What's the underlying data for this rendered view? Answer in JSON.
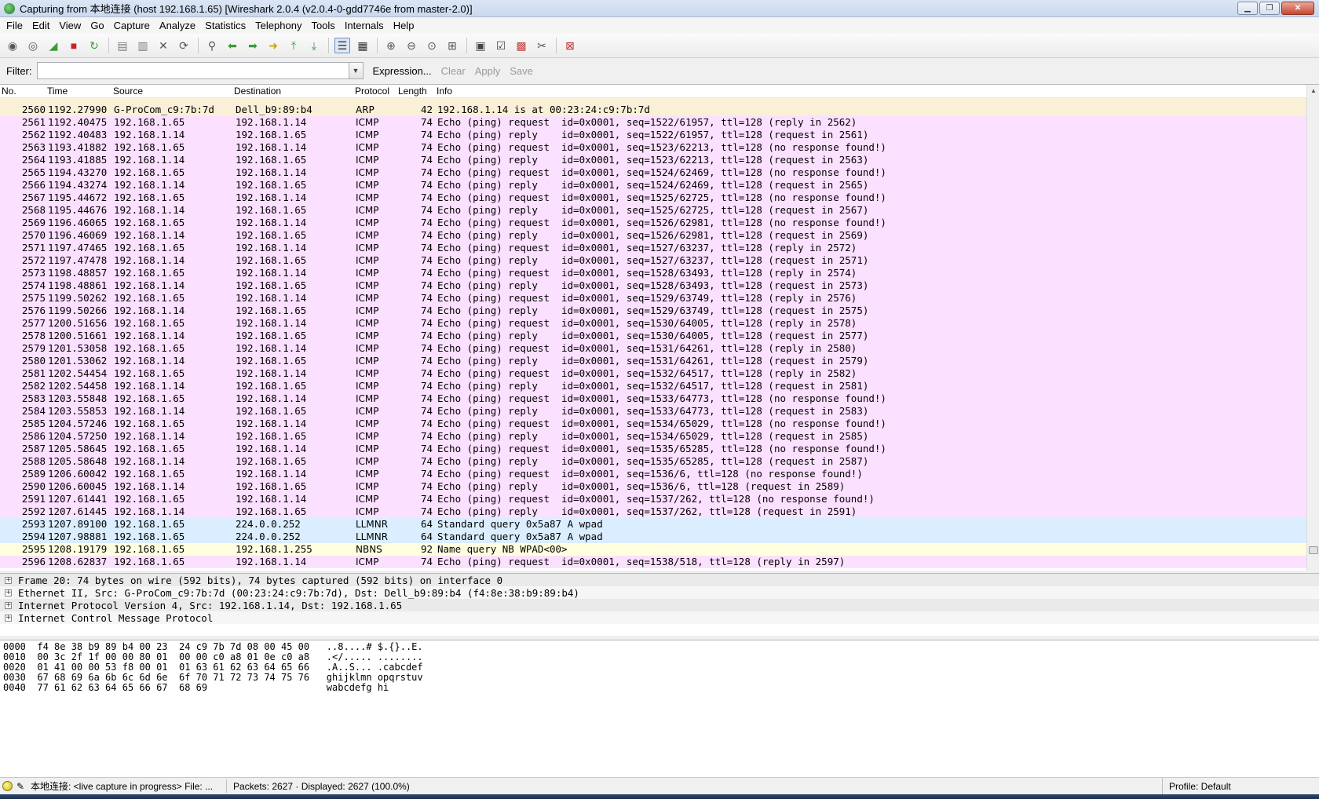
{
  "window": {
    "title": "Capturing from 本地连接 (host 192.168.1.65) [Wireshark 2.0.4 (v2.0.4-0-gdd7746e from master-2.0)]",
    "buttons": [
      "minimize",
      "maximize",
      "close"
    ]
  },
  "menu": [
    "File",
    "Edit",
    "View",
    "Go",
    "Capture",
    "Analyze",
    "Statistics",
    "Telephony",
    "Tools",
    "Internals",
    "Help"
  ],
  "toolbar": {
    "icons": [
      {
        "name": "interfaces-icon",
        "glyph": "◉",
        "color": "#555555"
      },
      {
        "name": "options-icon",
        "glyph": "◎",
        "color": "#555555"
      },
      {
        "name": "start-capture-icon",
        "glyph": "◢",
        "color": "#3c9a3c"
      },
      {
        "name": "stop-capture-icon",
        "glyph": "■",
        "color": "#d02020"
      },
      {
        "name": "restart-capture-icon",
        "glyph": "↻",
        "color": "#3c9a3c"
      },
      {
        "name": "sep",
        "glyph": "",
        "color": ""
      },
      {
        "name": "open-file-icon",
        "glyph": "▤",
        "color": "#7a7a7a"
      },
      {
        "name": "save-file-icon",
        "glyph": "▥",
        "color": "#7a7a7a"
      },
      {
        "name": "close-file-icon",
        "glyph": "✕",
        "color": "#555555"
      },
      {
        "name": "reload-icon",
        "glyph": "⟳",
        "color": "#555555"
      },
      {
        "name": "sep",
        "glyph": "",
        "color": ""
      },
      {
        "name": "find-packet-icon",
        "glyph": "⚲",
        "color": "#555555"
      },
      {
        "name": "go-back-icon",
        "glyph": "⬅",
        "color": "#3c9a3c"
      },
      {
        "name": "go-forward-icon",
        "glyph": "➡",
        "color": "#3c9a3c"
      },
      {
        "name": "go-to-packet-icon",
        "glyph": "➜",
        "color": "#c9a400"
      },
      {
        "name": "first-packet-icon",
        "glyph": "⤒",
        "color": "#3c9a3c"
      },
      {
        "name": "last-packet-icon",
        "glyph": "⤓",
        "color": "#3c9a3c"
      },
      {
        "name": "sep",
        "glyph": "",
        "color": ""
      },
      {
        "name": "colorize-icon",
        "glyph": "☰",
        "color": "#333333"
      },
      {
        "name": "auto-scroll-icon",
        "glyph": "▦",
        "color": "#333333"
      },
      {
        "name": "sep",
        "glyph": "",
        "color": ""
      },
      {
        "name": "zoom-in-icon",
        "glyph": "⊕",
        "color": "#555555"
      },
      {
        "name": "zoom-out-icon",
        "glyph": "⊖",
        "color": "#555555"
      },
      {
        "name": "normal-size-icon",
        "glyph": "⊙",
        "color": "#555555"
      },
      {
        "name": "resize-columns-icon",
        "glyph": "⊞",
        "color": "#555555"
      },
      {
        "name": "sep",
        "glyph": "",
        "color": ""
      },
      {
        "name": "capture-filters-icon",
        "glyph": "▣",
        "color": "#444444"
      },
      {
        "name": "display-filters-icon",
        "glyph": "☑",
        "color": "#444444"
      },
      {
        "name": "coloring-rules-icon",
        "glyph": "▩",
        "color": "#c04040"
      },
      {
        "name": "preferences-icon",
        "glyph": "✂",
        "color": "#555555"
      },
      {
        "name": "sep",
        "glyph": "",
        "color": ""
      },
      {
        "name": "help-icon",
        "glyph": "⊠",
        "color": "#c03030"
      }
    ]
  },
  "filter": {
    "label": "Filter:",
    "value": "",
    "buttons": {
      "expression": "Expression...",
      "clear": "Clear",
      "apply": "Apply",
      "save": "Save"
    }
  },
  "packet_list": {
    "columns": [
      "No.",
      "Time",
      "Source",
      "Destination",
      "Protocol",
      "Length",
      "Info"
    ],
    "colors": {
      "arp": "#faf0d7",
      "icmp": "#fce0ff",
      "llmnr": "#daeeff",
      "nbns": "#ffffe0"
    },
    "rows": [
      {
        "kind": "arp",
        "no": "2560",
        "time": "1192.27990",
        "src": "G-ProCom_c9:7b:7d",
        "dst": "Dell_b9:89:b4",
        "proto": "ARP",
        "len": "42",
        "info": "192.168.1.14 is at 00:23:24:c9:7b:7d"
      },
      {
        "kind": "icmp",
        "no": "2561",
        "time": "1192.40475",
        "src": "192.168.1.65",
        "dst": "192.168.1.14",
        "proto": "ICMP",
        "len": "74",
        "info": "Echo (ping) request  id=0x0001, seq=1522/61957, ttl=128 (reply in 2562)"
      },
      {
        "kind": "icmp",
        "no": "2562",
        "time": "1192.40483",
        "src": "192.168.1.14",
        "dst": "192.168.1.65",
        "proto": "ICMP",
        "len": "74",
        "info": "Echo (ping) reply    id=0x0001, seq=1522/61957, ttl=128 (request in 2561)"
      },
      {
        "kind": "icmp",
        "no": "2563",
        "time": "1193.41882",
        "src": "192.168.1.65",
        "dst": "192.168.1.14",
        "proto": "ICMP",
        "len": "74",
        "info": "Echo (ping) request  id=0x0001, seq=1523/62213, ttl=128 (no response found!)"
      },
      {
        "kind": "icmp",
        "no": "2564",
        "time": "1193.41885",
        "src": "192.168.1.14",
        "dst": "192.168.1.65",
        "proto": "ICMP",
        "len": "74",
        "info": "Echo (ping) reply    id=0x0001, seq=1523/62213, ttl=128 (request in 2563)"
      },
      {
        "kind": "icmp",
        "no": "2565",
        "time": "1194.43270",
        "src": "192.168.1.65",
        "dst": "192.168.1.14",
        "proto": "ICMP",
        "len": "74",
        "info": "Echo (ping) request  id=0x0001, seq=1524/62469, ttl=128 (no response found!)"
      },
      {
        "kind": "icmp",
        "no": "2566",
        "time": "1194.43274",
        "src": "192.168.1.14",
        "dst": "192.168.1.65",
        "proto": "ICMP",
        "len": "74",
        "info": "Echo (ping) reply    id=0x0001, seq=1524/62469, ttl=128 (request in 2565)"
      },
      {
        "kind": "icmp",
        "no": "2567",
        "time": "1195.44672",
        "src": "192.168.1.65",
        "dst": "192.168.1.14",
        "proto": "ICMP",
        "len": "74",
        "info": "Echo (ping) request  id=0x0001, seq=1525/62725, ttl=128 (no response found!)"
      },
      {
        "kind": "icmp",
        "no": "2568",
        "time": "1195.44676",
        "src": "192.168.1.14",
        "dst": "192.168.1.65",
        "proto": "ICMP",
        "len": "74",
        "info": "Echo (ping) reply    id=0x0001, seq=1525/62725, ttl=128 (request in 2567)"
      },
      {
        "kind": "icmp",
        "no": "2569",
        "time": "1196.46065",
        "src": "192.168.1.65",
        "dst": "192.168.1.14",
        "proto": "ICMP",
        "len": "74",
        "info": "Echo (ping) request  id=0x0001, seq=1526/62981, ttl=128 (no response found!)"
      },
      {
        "kind": "icmp",
        "no": "2570",
        "time": "1196.46069",
        "src": "192.168.1.14",
        "dst": "192.168.1.65",
        "proto": "ICMP",
        "len": "74",
        "info": "Echo (ping) reply    id=0x0001, seq=1526/62981, ttl=128 (request in 2569)"
      },
      {
        "kind": "icmp",
        "no": "2571",
        "time": "1197.47465",
        "src": "192.168.1.65",
        "dst": "192.168.1.14",
        "proto": "ICMP",
        "len": "74",
        "info": "Echo (ping) request  id=0x0001, seq=1527/63237, ttl=128 (reply in 2572)"
      },
      {
        "kind": "icmp",
        "no": "2572",
        "time": "1197.47478",
        "src": "192.168.1.14",
        "dst": "192.168.1.65",
        "proto": "ICMP",
        "len": "74",
        "info": "Echo (ping) reply    id=0x0001, seq=1527/63237, ttl=128 (request in 2571)"
      },
      {
        "kind": "icmp",
        "no": "2573",
        "time": "1198.48857",
        "src": "192.168.1.65",
        "dst": "192.168.1.14",
        "proto": "ICMP",
        "len": "74",
        "info": "Echo (ping) request  id=0x0001, seq=1528/63493, ttl=128 (reply in 2574)"
      },
      {
        "kind": "icmp",
        "no": "2574",
        "time": "1198.48861",
        "src": "192.168.1.14",
        "dst": "192.168.1.65",
        "proto": "ICMP",
        "len": "74",
        "info": "Echo (ping) reply    id=0x0001, seq=1528/63493, ttl=128 (request in 2573)"
      },
      {
        "kind": "icmp",
        "no": "2575",
        "time": "1199.50262",
        "src": "192.168.1.65",
        "dst": "192.168.1.14",
        "proto": "ICMP",
        "len": "74",
        "info": "Echo (ping) request  id=0x0001, seq=1529/63749, ttl=128 (reply in 2576)"
      },
      {
        "kind": "icmp",
        "no": "2576",
        "time": "1199.50266",
        "src": "192.168.1.14",
        "dst": "192.168.1.65",
        "proto": "ICMP",
        "len": "74",
        "info": "Echo (ping) reply    id=0x0001, seq=1529/63749, ttl=128 (request in 2575)"
      },
      {
        "kind": "icmp",
        "no": "2577",
        "time": "1200.51656",
        "src": "192.168.1.65",
        "dst": "192.168.1.14",
        "proto": "ICMP",
        "len": "74",
        "info": "Echo (ping) request  id=0x0001, seq=1530/64005, ttl=128 (reply in 2578)"
      },
      {
        "kind": "icmp",
        "no": "2578",
        "time": "1200.51661",
        "src": "192.168.1.14",
        "dst": "192.168.1.65",
        "proto": "ICMP",
        "len": "74",
        "info": "Echo (ping) reply    id=0x0001, seq=1530/64005, ttl=128 (request in 2577)"
      },
      {
        "kind": "icmp",
        "no": "2579",
        "time": "1201.53058",
        "src": "192.168.1.65",
        "dst": "192.168.1.14",
        "proto": "ICMP",
        "len": "74",
        "info": "Echo (ping) request  id=0x0001, seq=1531/64261, ttl=128 (reply in 2580)"
      },
      {
        "kind": "icmp",
        "no": "2580",
        "time": "1201.53062",
        "src": "192.168.1.14",
        "dst": "192.168.1.65",
        "proto": "ICMP",
        "len": "74",
        "info": "Echo (ping) reply    id=0x0001, seq=1531/64261, ttl=128 (request in 2579)"
      },
      {
        "kind": "icmp",
        "no": "2581",
        "time": "1202.54454",
        "src": "192.168.1.65",
        "dst": "192.168.1.14",
        "proto": "ICMP",
        "len": "74",
        "info": "Echo (ping) request  id=0x0001, seq=1532/64517, ttl=128 (reply in 2582)"
      },
      {
        "kind": "icmp",
        "no": "2582",
        "time": "1202.54458",
        "src": "192.168.1.14",
        "dst": "192.168.1.65",
        "proto": "ICMP",
        "len": "74",
        "info": "Echo (ping) reply    id=0x0001, seq=1532/64517, ttl=128 (request in 2581)"
      },
      {
        "kind": "icmp",
        "no": "2583",
        "time": "1203.55848",
        "src": "192.168.1.65",
        "dst": "192.168.1.14",
        "proto": "ICMP",
        "len": "74",
        "info": "Echo (ping) request  id=0x0001, seq=1533/64773, ttl=128 (no response found!)"
      },
      {
        "kind": "icmp",
        "no": "2584",
        "time": "1203.55853",
        "src": "192.168.1.14",
        "dst": "192.168.1.65",
        "proto": "ICMP",
        "len": "74",
        "info": "Echo (ping) reply    id=0x0001, seq=1533/64773, ttl=128 (request in 2583)"
      },
      {
        "kind": "icmp",
        "no": "2585",
        "time": "1204.57246",
        "src": "192.168.1.65",
        "dst": "192.168.1.14",
        "proto": "ICMP",
        "len": "74",
        "info": "Echo (ping) request  id=0x0001, seq=1534/65029, ttl=128 (no response found!)"
      },
      {
        "kind": "icmp",
        "no": "2586",
        "time": "1204.57250",
        "src": "192.168.1.14",
        "dst": "192.168.1.65",
        "proto": "ICMP",
        "len": "74",
        "info": "Echo (ping) reply    id=0x0001, seq=1534/65029, ttl=128 (request in 2585)"
      },
      {
        "kind": "icmp",
        "no": "2587",
        "time": "1205.58645",
        "src": "192.168.1.65",
        "dst": "192.168.1.14",
        "proto": "ICMP",
        "len": "74",
        "info": "Echo (ping) request  id=0x0001, seq=1535/65285, ttl=128 (no response found!)"
      },
      {
        "kind": "icmp",
        "no": "2588",
        "time": "1205.58648",
        "src": "192.168.1.14",
        "dst": "192.168.1.65",
        "proto": "ICMP",
        "len": "74",
        "info": "Echo (ping) reply    id=0x0001, seq=1535/65285, ttl=128 (request in 2587)"
      },
      {
        "kind": "icmp",
        "no": "2589",
        "time": "1206.60042",
        "src": "192.168.1.65",
        "dst": "192.168.1.14",
        "proto": "ICMP",
        "len": "74",
        "info": "Echo (ping) request  id=0x0001, seq=1536/6, ttl=128 (no response found!)"
      },
      {
        "kind": "icmp",
        "no": "2590",
        "time": "1206.60045",
        "src": "192.168.1.14",
        "dst": "192.168.1.65",
        "proto": "ICMP",
        "len": "74",
        "info": "Echo (ping) reply    id=0x0001, seq=1536/6, ttl=128 (request in 2589)"
      },
      {
        "kind": "icmp",
        "no": "2591",
        "time": "1207.61441",
        "src": "192.168.1.65",
        "dst": "192.168.1.14",
        "proto": "ICMP",
        "len": "74",
        "info": "Echo (ping) request  id=0x0001, seq=1537/262, ttl=128 (no response found!)"
      },
      {
        "kind": "icmp",
        "no": "2592",
        "time": "1207.61445",
        "src": "192.168.1.14",
        "dst": "192.168.1.65",
        "proto": "ICMP",
        "len": "74",
        "info": "Echo (ping) reply    id=0x0001, seq=1537/262, ttl=128 (request in 2591)"
      },
      {
        "kind": "llmnr",
        "no": "2593",
        "time": "1207.89100",
        "src": "192.168.1.65",
        "dst": "224.0.0.252",
        "proto": "LLMNR",
        "len": "64",
        "info": "Standard query 0x5a87 A wpad"
      },
      {
        "kind": "llmnr",
        "no": "2594",
        "time": "1207.98881",
        "src": "192.168.1.65",
        "dst": "224.0.0.252",
        "proto": "LLMNR",
        "len": "64",
        "info": "Standard query 0x5a87 A wpad"
      },
      {
        "kind": "nbns",
        "no": "2595",
        "time": "1208.19179",
        "src": "192.168.1.65",
        "dst": "192.168.1.255",
        "proto": "NBNS",
        "len": "92",
        "info": "Name query NB WPAD<00>"
      },
      {
        "kind": "icmp",
        "no": "2596",
        "time": "1208.62837",
        "src": "192.168.1.65",
        "dst": "192.168.1.14",
        "proto": "ICMP",
        "len": "74",
        "info": "Echo (ping) request  id=0x0001, seq=1538/518, ttl=128 (reply in 2597)"
      }
    ]
  },
  "details": [
    "Frame 20: 74 bytes on wire (592 bits), 74 bytes captured (592 bits) on interface 0",
    "Ethernet II, Src: G-ProCom_c9:7b:7d (00:23:24:c9:7b:7d), Dst: Dell_b9:89:b4 (f4:8e:38:b9:89:b4)",
    "Internet Protocol Version 4, Src: 192.168.1.14, Dst: 192.168.1.65",
    "Internet Control Message Protocol"
  ],
  "bytes": [
    "0000  f4 8e 38 b9 89 b4 00 23  24 c9 7b 7d 08 00 45 00   ..8....# $.{}..E.",
    "0010  00 3c 2f 1f 00 00 80 01  00 00 c0 a8 01 0e c0 a8   .</..... ........",
    "0020  01 41 00 00 53 f8 00 01  01 63 61 62 63 64 65 66   .A..S... .cabcdef",
    "0030  67 68 69 6a 6b 6c 6d 6e  6f 70 71 72 73 74 75 76   ghijklmn opqrstuv",
    "0040  77 61 62 63 64 65 66 67  68 69                     wabcdefg hi"
  ],
  "status": {
    "capture": "本地连接: <live capture in progress> File: ...",
    "packets": "Packets: 2627 · Displayed: 2627 (100.0%)",
    "profile": "Profile: Default"
  }
}
